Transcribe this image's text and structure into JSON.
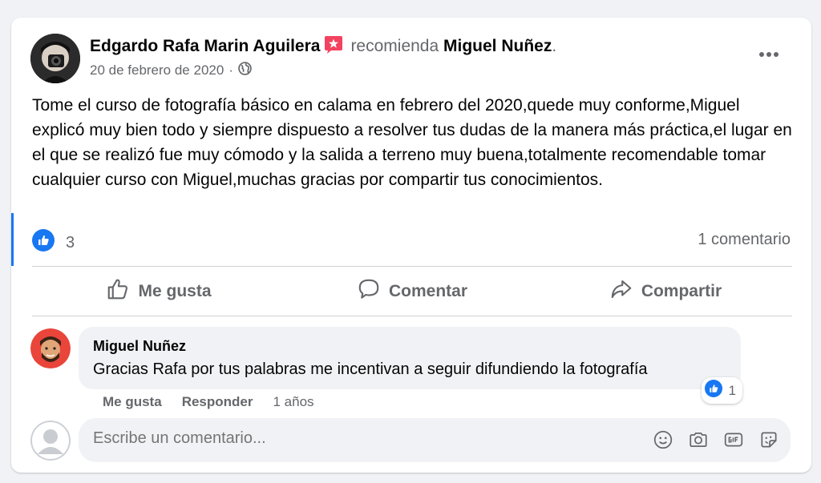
{
  "post": {
    "author": "Edgardo Rafa Marin Aguilera",
    "recommends": "recomienda",
    "page": "Miguel Nuñez",
    "period": ".",
    "date": "20 de febrero de 2020",
    "separator": "·",
    "audience_icon": "globe-icon",
    "text": "Tome el curso de fotografía básico en calama en febrero del 2020,quede muy conforme,Miguel explicó muy bien todo y siempre dispuesto a resolver tus dudas de la manera más práctica,el lugar en el que se realizó fue muy cómodo y la salida a terreno muy buena,totalmente recomendable tomar cualquier curso con Miguel,muchas gracias por compartir tus conocimientos.",
    "reaction_count": "3",
    "comment_count": "1 comentario"
  },
  "actions": {
    "like": "Me gusta",
    "comment": "Comentar",
    "share": "Compartir"
  },
  "comment": {
    "author": "Miguel Nuñez",
    "text": "Gracias Rafa por tus palabras me incentivan a seguir difundiendo la fotografía",
    "reaction_count": "1",
    "like_label": "Me gusta",
    "reply_label": "Responder",
    "age": "1 años"
  },
  "composer": {
    "placeholder": "Escribe un comentario..."
  },
  "colors": {
    "accent": "#1877f2",
    "badge": "#f3425f",
    "secondary_text": "#65676b",
    "bubble": "#f0f2f5"
  }
}
